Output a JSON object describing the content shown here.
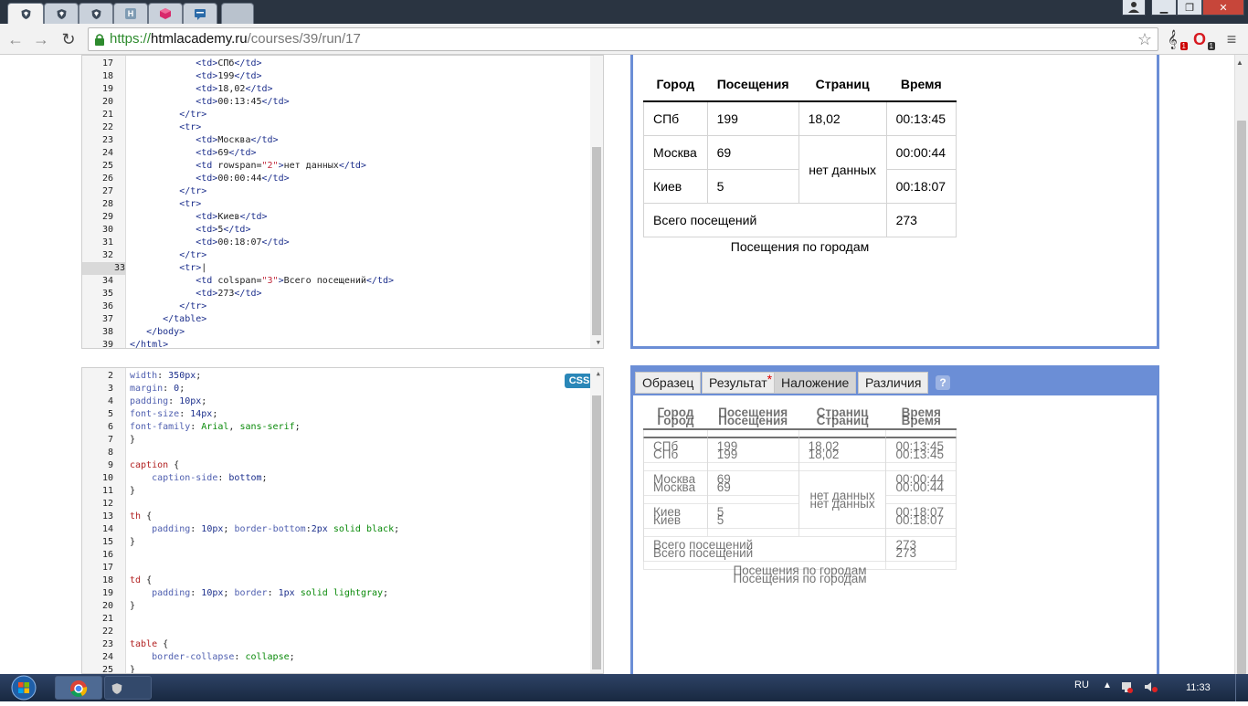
{
  "browser": {
    "url_prefix": "https://",
    "url_host": "htmlacademy.ru",
    "url_path": "/courses/39/run/17",
    "tabs": [
      {
        "icon": "shield-icon",
        "active": true
      },
      {
        "icon": "shield-icon",
        "active": false
      },
      {
        "icon": "shield-icon",
        "active": false
      },
      {
        "icon": "h-icon",
        "glyph": "H",
        "active": false
      },
      {
        "icon": "cube-icon",
        "active": false
      },
      {
        "icon": "chat-icon",
        "active": false
      }
    ],
    "ext_badge_1": "1",
    "ext_badge_2": "1"
  },
  "html_editor": {
    "lines": [
      {
        "n": "17",
        "html": "            <span class='tg'>&lt;td&gt;</span>СПб<span class='tg'>&lt;/td&gt;</span>"
      },
      {
        "n": "18",
        "html": "            <span class='tg'>&lt;td&gt;</span>199<span class='tg'>&lt;/td&gt;</span>"
      },
      {
        "n": "19",
        "html": "            <span class='tg'>&lt;td&gt;</span>18,02<span class='tg'>&lt;/td&gt;</span>"
      },
      {
        "n": "20",
        "html": "            <span class='tg'>&lt;td&gt;</span>00:13:45<span class='tg'>&lt;/td&gt;</span>"
      },
      {
        "n": "21",
        "html": "         <span class='tg'>&lt;/tr&gt;</span>"
      },
      {
        "n": "22",
        "html": "         <span class='tg'>&lt;tr&gt;</span>"
      },
      {
        "n": "23",
        "html": "            <span class='tg'>&lt;td&gt;</span>Москва<span class='tg'>&lt;/td&gt;</span>"
      },
      {
        "n": "24",
        "html": "            <span class='tg'>&lt;td&gt;</span>69<span class='tg'>&lt;/td&gt;</span>"
      },
      {
        "n": "25",
        "html": "            <span class='tg'>&lt;td</span> rowspan=<span class='st'>\"2\"</span><span class='tg'>&gt;</span>нет данных<span class='tg'>&lt;/td&gt;</span>"
      },
      {
        "n": "26",
        "html": "            <span class='tg'>&lt;td&gt;</span>00:00:44<span class='tg'>&lt;/td&gt;</span>"
      },
      {
        "n": "27",
        "html": "         <span class='tg'>&lt;/tr&gt;</span>"
      },
      {
        "n": "28",
        "html": "         <span class='tg'>&lt;tr&gt;</span>"
      },
      {
        "n": "29",
        "html": "            <span class='tg'>&lt;td&gt;</span>Киев<span class='tg'>&lt;/td&gt;</span>"
      },
      {
        "n": "30",
        "html": "            <span class='tg'>&lt;td&gt;</span>5<span class='tg'>&lt;/td&gt;</span>"
      },
      {
        "n": "31",
        "html": "            <span class='tg'>&lt;td&gt;</span>00:18:07<span class='tg'>&lt;/td&gt;</span>"
      },
      {
        "n": "32",
        "html": "         <span class='tg'>&lt;/tr&gt;</span>"
      },
      {
        "n": "33",
        "html": "         <span class='tg'>&lt;tr&gt;</span>|",
        "current": true
      },
      {
        "n": "34",
        "html": "            <span class='tg'>&lt;td</span> colspan=<span class='st'>\"3\"</span><span class='tg'>&gt;</span>Всего посещений<span class='tg'>&lt;/td&gt;</span>"
      },
      {
        "n": "35",
        "html": "            <span class='tg'>&lt;td&gt;</span>273<span class='tg'>&lt;/td&gt;</span>"
      },
      {
        "n": "36",
        "html": "         <span class='tg'>&lt;/tr&gt;</span>"
      },
      {
        "n": "37",
        "html": "      <span class='tg'>&lt;/table&gt;</span>"
      },
      {
        "n": "38",
        "html": "   <span class='tg'>&lt;/body&gt;</span>"
      },
      {
        "n": "39",
        "html": "<span class='tg'>&lt;/html&gt;</span>"
      }
    ]
  },
  "css_editor": {
    "badge": "CSS",
    "lines": [
      {
        "n": "2",
        "html": "<span class='pp'>width</span>: <span class='nm'>350px</span>;"
      },
      {
        "n": "3",
        "html": "<span class='pp'>margin</span>: <span class='nm'>0</span>;"
      },
      {
        "n": "4",
        "html": "<span class='pp'>padding</span>: <span class='nm'>10px</span>;"
      },
      {
        "n": "5",
        "html": "<span class='pp'>font-size</span>: <span class='nm'>14px</span>;"
      },
      {
        "n": "6",
        "html": "<span class='pp'>font-family</span>: <span class='vl'>Arial</span>, <span class='vl'>sans-serif</span>;"
      },
      {
        "n": "7",
        "html": "}"
      },
      {
        "n": "8",
        "html": ""
      },
      {
        "n": "9",
        "html": "<span class='se'>caption</span> {"
      },
      {
        "n": "10",
        "html": "    <span class='pp'>caption-side</span>: <span class='nm'>bottom</span>;"
      },
      {
        "n": "11",
        "html": "}"
      },
      {
        "n": "12",
        "html": ""
      },
      {
        "n": "13",
        "html": "<span class='se'>th</span> {"
      },
      {
        "n": "14",
        "html": "    <span class='pp'>padding</span>: <span class='nm'>10px</span>; <span class='pp'>border-bottom</span>:<span class='nm'>2px</span> <span class='vl'>solid</span> <span class='vl'>black</span>;"
      },
      {
        "n": "15",
        "html": "}"
      },
      {
        "n": "16",
        "html": ""
      },
      {
        "n": "17",
        "html": ""
      },
      {
        "n": "18",
        "html": "<span class='se'>td</span> {"
      },
      {
        "n": "19",
        "html": "    <span class='pp'>padding</span>: <span class='nm'>10px</span>; <span class='pp'>border</span>: <span class='nm'>1px</span> <span class='vl'>solid</span> <span class='vl'>lightgray</span>;"
      },
      {
        "n": "20",
        "html": "}"
      },
      {
        "n": "21",
        "html": ""
      },
      {
        "n": "22",
        "html": ""
      },
      {
        "n": "23",
        "html": "<span class='se'>table</span> {"
      },
      {
        "n": "24",
        "html": "    <span class='pp'>border-collapse</span>: <span class='vl'>collapse</span>;"
      },
      {
        "n": "25",
        "html": "}"
      }
    ]
  },
  "result_table": {
    "headers": [
      "Город",
      "Посещения",
      "Страниц",
      "Время"
    ],
    "rows": [
      [
        "СПб",
        "199",
        "18,02",
        "00:13:45"
      ],
      [
        "Москва",
        "69",
        "нет данных",
        "00:00:44"
      ],
      [
        "Киев",
        "5",
        "00:18:07"
      ]
    ],
    "total_label": "Всего посещений",
    "total_value": "273",
    "caption": "Посещения по городам"
  },
  "output_tabs": [
    "Образец",
    "Результат",
    "Наложение",
    "Различия"
  ],
  "output_tab_asterisk": "*",
  "help_label": "?",
  "taskbar": {
    "lang": "RU",
    "time": "11:33"
  }
}
